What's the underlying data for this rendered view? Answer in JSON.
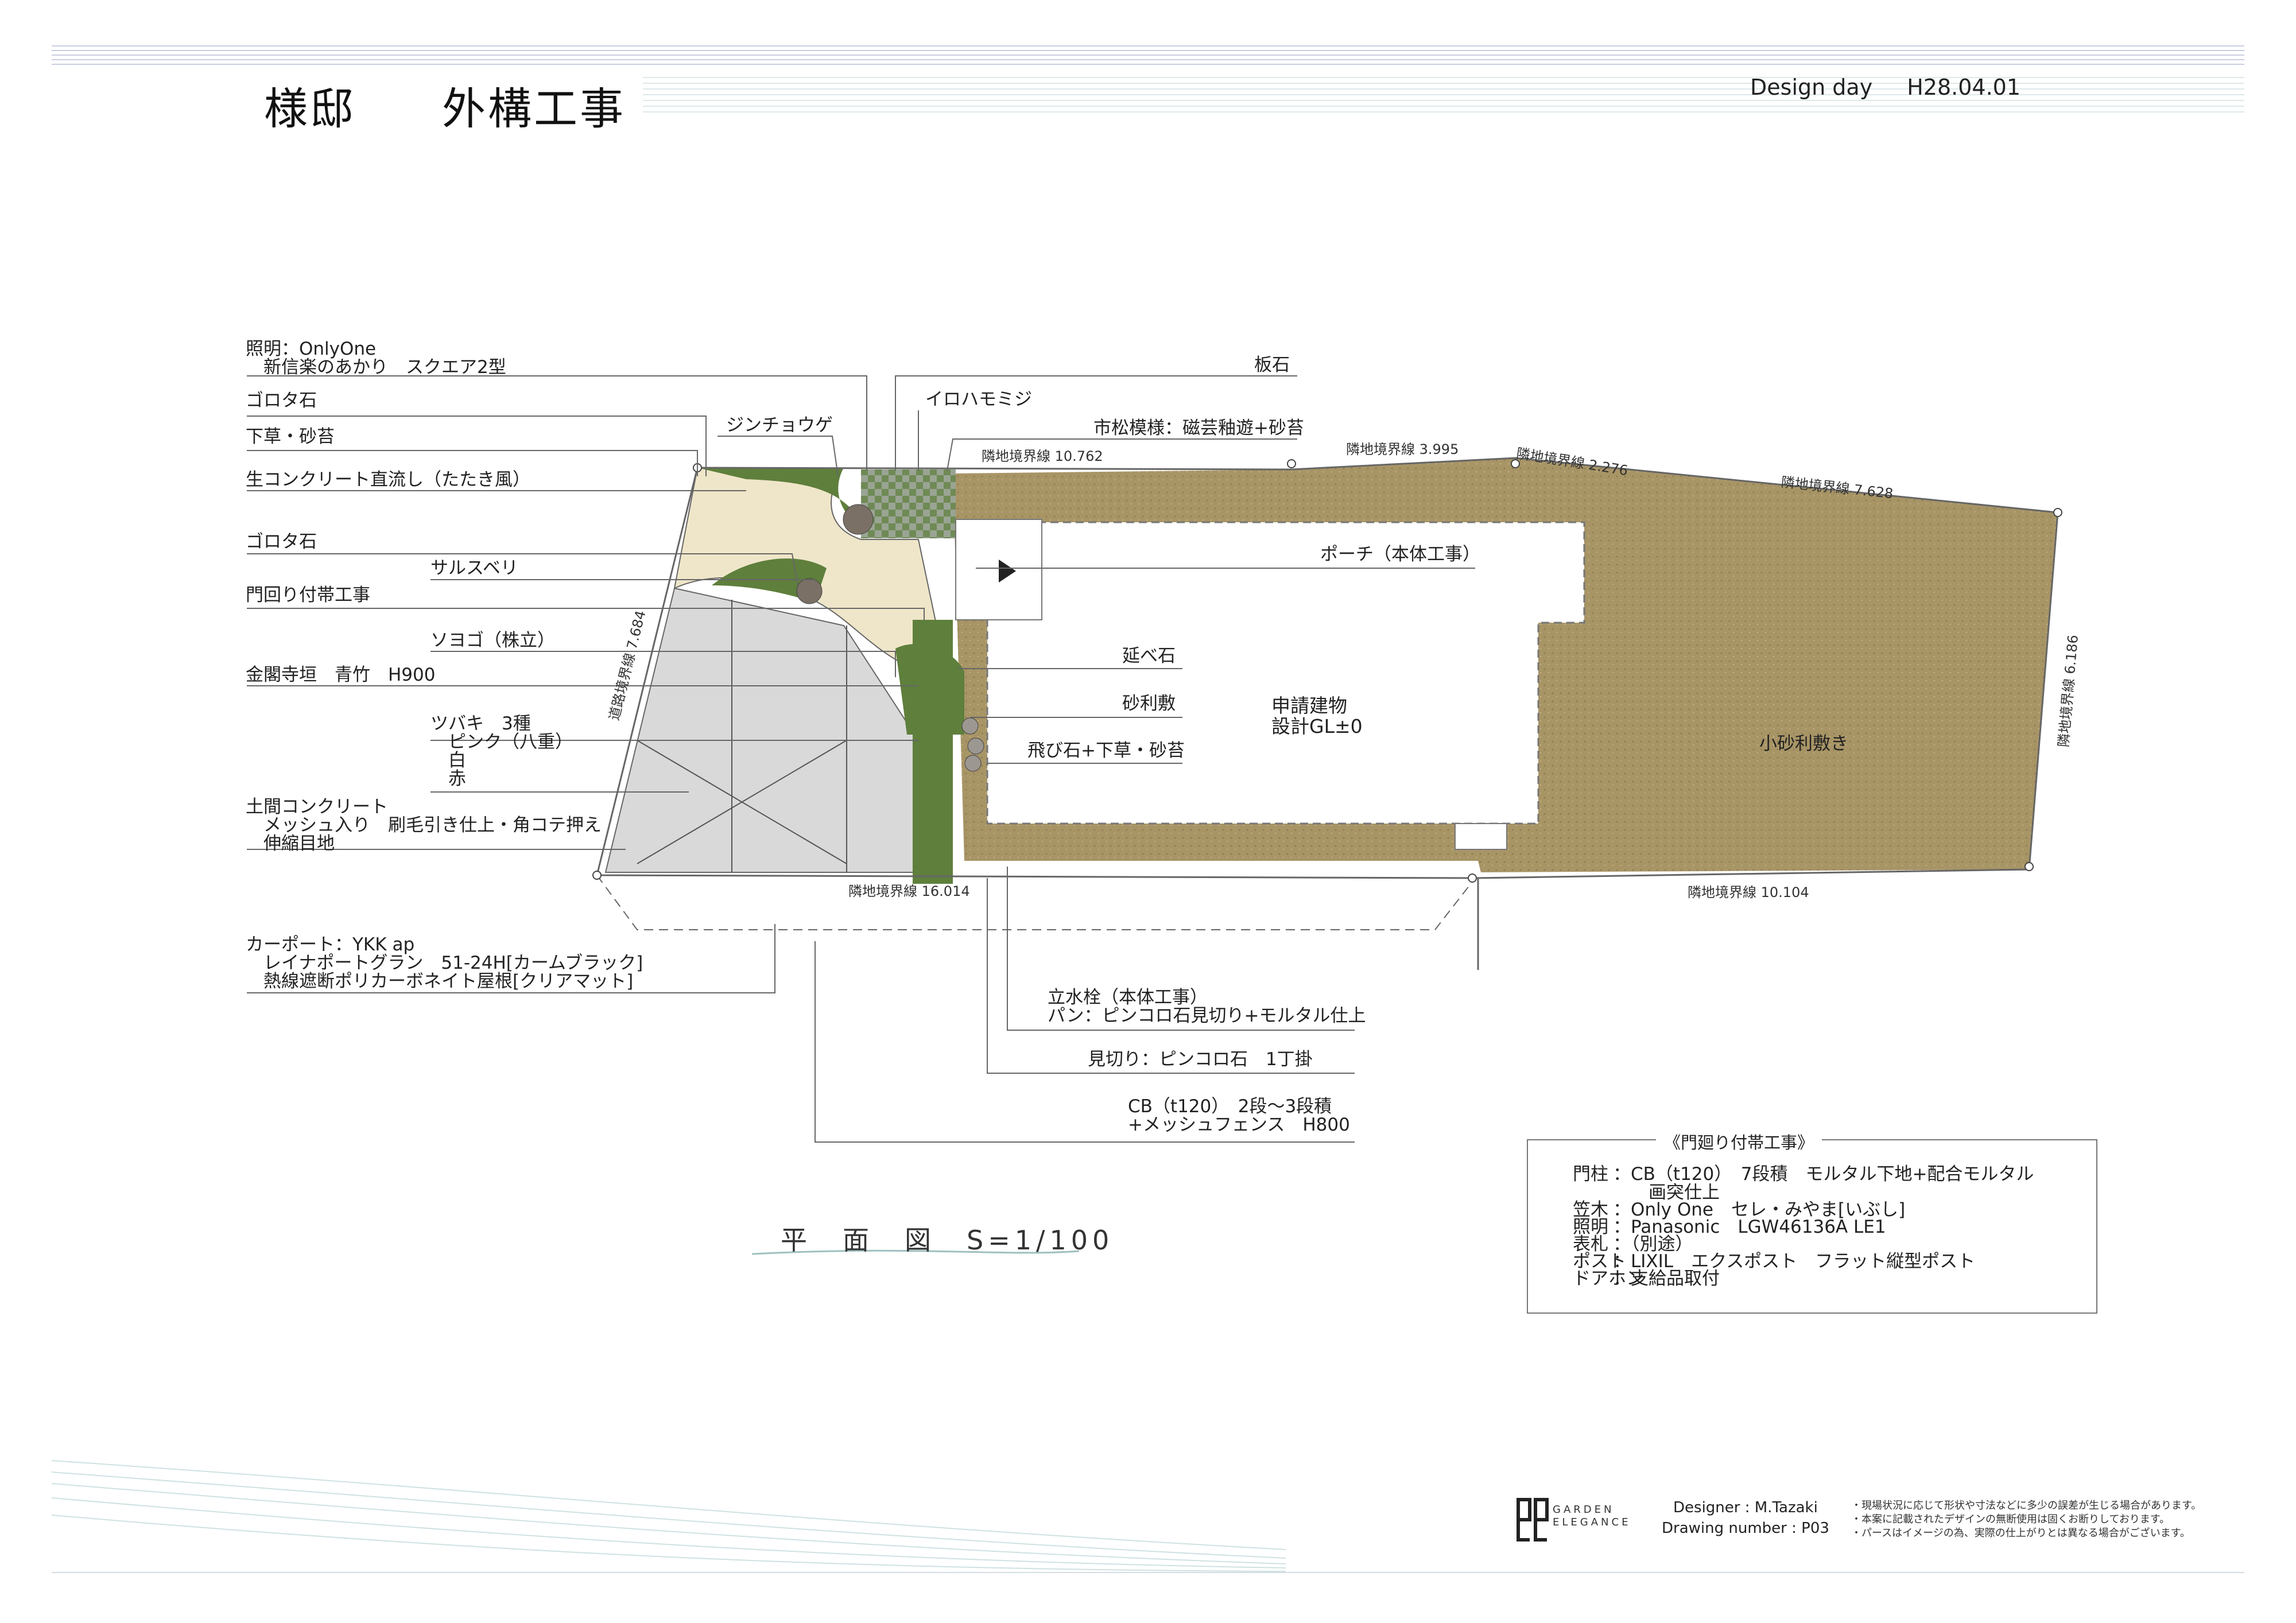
{
  "header": {
    "title_owner": "様邸",
    "title_work": "外構工事",
    "design_day_label": "Design day",
    "design_day_value": "H28.04.01"
  },
  "labels": {
    "lighting": "照明：OnlyOne\n　新信楽のあかり　スクエア2型",
    "gorota1": "ゴロタ石",
    "shitakusa": "下草・砂苔",
    "concrete_tataki": "生コンクリート直流し（たたき風）",
    "gorota2": "ゴロタ石",
    "sarusuberi": "サルスベリ",
    "gate_work": "門回り付帯工事",
    "soyogo": "ソヨゴ（株立）",
    "kinkakuji": "金閣寺垣　青竹　H900",
    "tsubaki": "ツバキ　3種\n　ピンク（八重）\n　白\n　赤",
    "doma_concrete": "土間コンクリート\n　メッシュ入り　刷毛引き仕上・角コテ押え\n　伸縮目地",
    "carport": "カーポート：YKK ap\n　レイナポートグラン　51-24H[カームブラック]\n　熱線遮断ポリカーボネイト屋根[クリアマット]",
    "jinchouge": "ジンチョウゲ",
    "irohamomiji": "イロハモミジ",
    "itaishi": "板石",
    "ichimatsu": "市松模様：磁芸釉遊+砂苔",
    "porch": "ポーチ（本体工事）",
    "nobeishi": "延べ石",
    "jarishiki": "砂利敷",
    "tobiishi": "飛び石+下草・砂苔",
    "building": "申請建物\n設計GL±0",
    "kojari": "小砂利敷き",
    "faucet": "立水栓（本体工事）\nパン：ピンコロ石見切り+モルタル仕上",
    "mikiri": "見切り：ピンコロ石　1丁掛",
    "cb_fence": "CB（t120）　2段～3段積\n+メッシュフェンス　H800"
  },
  "dimensions": {
    "north_left": "隣地境界線 10.762",
    "north_mid": "隣地境界線 3.995",
    "north_angled": "隣地境界線 2.276",
    "north_right": "隣地境界線 7.628",
    "east": "隣地境界線 6.186",
    "south_left": "隣地境界線 16.014",
    "south_right": "隣地境界線 10.104",
    "west": "道路境界線 7.684"
  },
  "scale_label": "平　面　図　S=1/100",
  "legend": {
    "title": "《門廻り付帯工事》",
    "rows": [
      {
        "key": "門柱",
        "value": "：CB（t120）　7段積　モルタル下地+配合モルタル\n　　画突仕上"
      },
      {
        "key": "笠木",
        "value": "：Only One　セレ・みやま[いぶし]"
      },
      {
        "key": "照明",
        "value": "：Panasonic　LGW46136A LE1"
      },
      {
        "key": "表札",
        "value": "：（別途）"
      },
      {
        "key": "ポスト",
        "value": "：LIXIL　エクスポスト　フラット縦型ポスト"
      },
      {
        "key": "ドアホン",
        "value": "：支給品取付"
      }
    ]
  },
  "footer": {
    "brand_top": "GARDEN",
    "brand_bottom": "ELEGANCE",
    "designer": "Designer : M.Tazaki",
    "drawing_number": "Drawing number : P03",
    "notes": "・現場状況に応じて形状や寸法などに多少の誤差が生じる場合があります。\n・本案に記載されたデザインの無断使用は固くお断りしております。\n・パースはイメージの為、実際の仕上がりとは異なる場合がございます。"
  },
  "colors": {
    "gravel": "#a89566",
    "concrete": "#d9d9d9",
    "tataki": "#efe6c9",
    "green": "#5f7f3c",
    "accent_line": "#9fb3c8"
  }
}
